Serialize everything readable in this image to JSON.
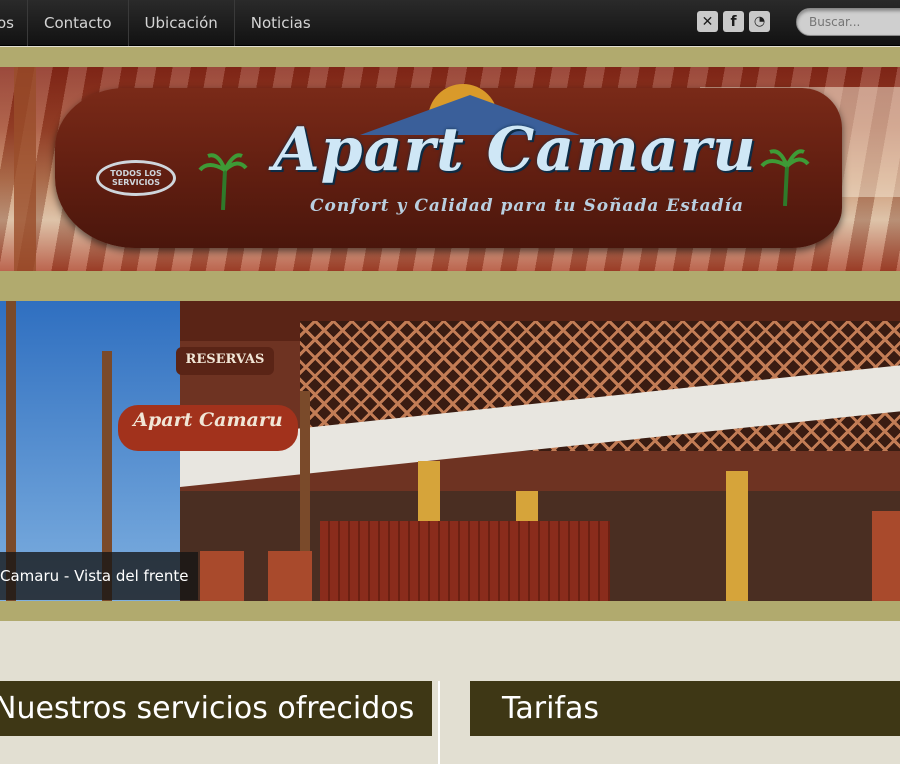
{
  "nav": {
    "items": [
      {
        "label": "os"
      },
      {
        "label": "Contacto"
      },
      {
        "label": "Ubicación"
      },
      {
        "label": "Noticias"
      }
    ],
    "social": [
      {
        "icon": "x-icon",
        "glyph": "✕"
      },
      {
        "icon": "facebook-icon",
        "glyph": "f"
      },
      {
        "icon": "rss-icon",
        "glyph": "◔"
      }
    ],
    "search_placeholder": "Buscar..."
  },
  "banner": {
    "title": "Apart Camaru",
    "subtitle": "Confort y Calidad para tu Soñada Estadía",
    "badge": "TODOS LOS SERVICIOS"
  },
  "hero": {
    "sign_reservas": "RESERVAS",
    "sign_small": "Apart Camaru",
    "caption": "Camaru - Vista del frente"
  },
  "sections": {
    "services_title": "Nuestros servicios ofrecidos",
    "rates_title": "Tarifas"
  },
  "colors": {
    "topbar": "#161616",
    "olive_band": "#b1aa6e",
    "panel": "#3e3715",
    "background": "#e2dfd2"
  }
}
